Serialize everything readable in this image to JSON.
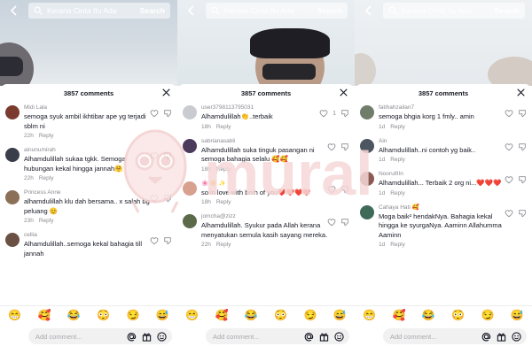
{
  "panels": [
    {
      "search_text": "Kerana Cinta Itu Ada",
      "search_button": "Search",
      "comments_header": "3857 comments",
      "input_placeholder": "Add comment...",
      "emojis": [
        "😁",
        "🥰",
        "😂",
        "😳",
        "😏",
        "😅"
      ],
      "comments": [
        {
          "user": "Midi Lala",
          "text": "semoga syuk ambil ikhtibar ape yg terjadi sblm ni",
          "time": "22h",
          "reply": "Reply",
          "likes": "",
          "avatar_color": "#7a3b2e"
        },
        {
          "user": "ainunumirah",
          "text": "Alhamdulillah sukaa tgkk. Semoga hubungan kekal hingga jannah🤗",
          "time": "22h",
          "reply": "Reply",
          "likes": "",
          "avatar_color": "#3a3d4a"
        },
        {
          "user": "Princess Anne",
          "text": "alhamdulillah klu dah bersama.. x salah bg peluang 😊",
          "time": "23h",
          "reply": "Reply",
          "likes": "",
          "avatar_color": "#8c6f57"
        },
        {
          "user": "cellia",
          "text": "Alhamdulillah..semoga kekal bahagia till jannah",
          "time": "",
          "reply": "",
          "likes": "",
          "avatar_color": "#6a5143"
        }
      ]
    },
    {
      "search_text": "Kerana Cinta Itu Ada",
      "search_button": "Search",
      "comments_header": "3857 comments",
      "input_placeholder": "Add comment...",
      "emojis": [
        "😁",
        "🥰",
        "😂",
        "😳",
        "😏",
        "😅"
      ],
      "comments": [
        {
          "user": "user3798113795031",
          "text": "Alhamdulillah👏..terbaik",
          "time": "18h",
          "reply": "Reply",
          "likes": "1",
          "avatar_color": "#c9cbd0"
        },
        {
          "user": "sabrianasabli",
          "text": "Alhamdulillah suka tinguk pasangan ni semoga bahagia selalu 🥰🥰",
          "time": "18h",
          "reply": "Reply",
          "likes": "",
          "avatar_color": "#4b3a5c"
        },
        {
          "user": "🌸 🌼 ✨",
          "text": "so in love with both of you❤️❤️❤️❤️",
          "time": "18h",
          "reply": "Reply",
          "likes": "",
          "avatar_color": "#d7a08f"
        },
        {
          "user": "jomcha@zizz",
          "text": "Alhamdulillah. Syukur pada Allah kerana menyatukan semula kasih sayang mereka.",
          "time": "22h",
          "reply": "Reply",
          "likes": "",
          "avatar_color": "#5b6b4a"
        }
      ]
    },
    {
      "search_text": "Kerana Cinta Itu Ada",
      "search_button": "Search",
      "comments_header": "3857 comments",
      "input_placeholder": "Add comment...",
      "emojis": [
        "😁",
        "🥰",
        "😂",
        "😳",
        "😏",
        "😅"
      ],
      "comments": [
        {
          "user": "fatihahzailan7",
          "text": "semoga bhgia korg 1 fmly.. amin",
          "time": "1d",
          "reply": "Reply",
          "likes": "",
          "avatar_color": "#6f7d6a"
        },
        {
          "user": "Ain",
          "text": "Alhamdulillah..ni contoh yg baik..",
          "time": "1d",
          "reply": "Reply",
          "likes": "",
          "avatar_color": "#4d5560"
        },
        {
          "user": "NoorulIlIn",
          "text": "Alhamdulillah... Terbaik 2 org ni...❤️❤️❤️",
          "time": "1d",
          "reply": "Reply",
          "likes": "",
          "avatar_color": "#8a5a53"
        },
        {
          "user": "Cahaya Hati 🥰",
          "text": "Moga baik² hendakNya. Bahagia kekal hingga ke syurgaNya. Aaminn Allahumma Aaminn",
          "time": "1d",
          "reply": "Reply",
          "likes": "",
          "avatar_color": "#3f6a5a"
        }
      ]
    }
  ],
  "colors": {
    "text_primary": "#161823",
    "text_secondary": "#8a8b91",
    "sheet_bg": "#ffffff",
    "input_bg": "#f1f1f2",
    "watermark": "#f2c8c8"
  },
  "watermark_text": "mural"
}
